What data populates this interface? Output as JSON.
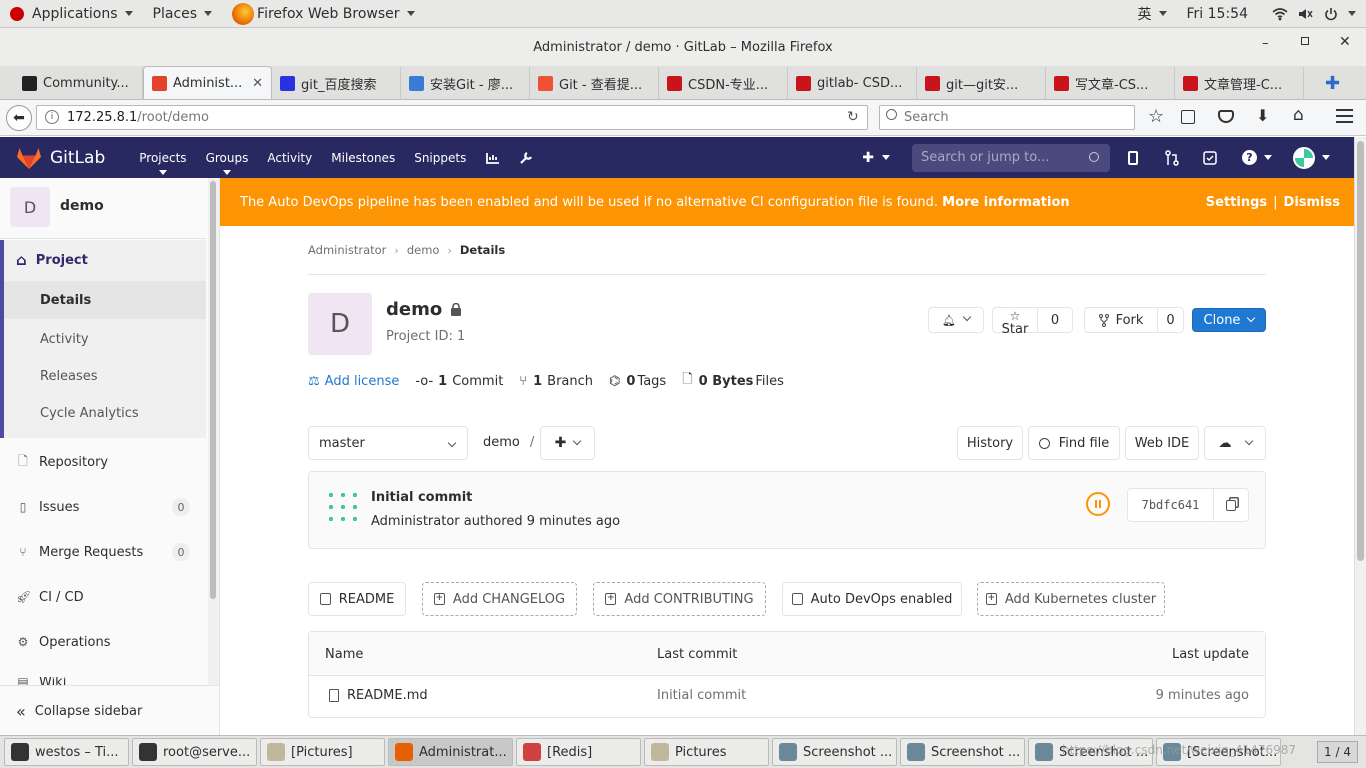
{
  "desktop": {
    "applications": "Applications",
    "places": "Places",
    "active_app": "Firefox Web Browser",
    "input_method": "英",
    "clock": "Fri 15:54"
  },
  "window": {
    "title": "Administrator / demo · GitLab – Mozilla Firefox"
  },
  "tabs": [
    {
      "label": "Community...",
      "icon": "community-icon",
      "color": "#222222"
    },
    {
      "label": "Administ...",
      "icon": "gitlab-icon",
      "color": "#e24329",
      "active": true
    },
    {
      "label": "git_百度搜索",
      "icon": "baidu-icon",
      "color": "#2932e1"
    },
    {
      "label": "安装Git - 廖...",
      "icon": "rocket-icon",
      "color": "#3a7bd5"
    },
    {
      "label": "Git - 查看提...",
      "icon": "git-icon",
      "color": "#f05033"
    },
    {
      "label": "CSDN-专业...",
      "icon": "csdn-icon",
      "color": "#c9141c"
    },
    {
      "label": "gitlab- CSD...",
      "icon": "csdn-icon",
      "color": "#c9141c"
    },
    {
      "label": "git—git安...",
      "icon": "csdn-icon",
      "color": "#c9141c"
    },
    {
      "label": "写文章-CS...",
      "icon": "csdn-icon",
      "color": "#c9141c"
    },
    {
      "label": "文章管理-C...",
      "icon": "csdn-icon",
      "color": "#c9141c"
    }
  ],
  "urlbar": {
    "host": "172.25.8.1",
    "path": "/root/demo",
    "search_placeholder": "Search"
  },
  "gitlab": {
    "logo": "GitLab",
    "nav": [
      "Projects",
      "Groups",
      "Activity",
      "Milestones",
      "Snippets"
    ],
    "search_placeholder": "Search or jump to...",
    "banner_text": "The Auto DevOps pipeline has been enabled and will be used if no alternative CI configuration file is found.",
    "banner_link": "More information",
    "banner_settings": "Settings",
    "banner_sep": "|",
    "banner_dismiss": "Dismiss"
  },
  "sidebar": {
    "avatar_letter": "D",
    "project_name": "demo",
    "section": "Project",
    "sub_items": [
      "Details",
      "Activity",
      "Releases",
      "Cycle Analytics"
    ],
    "items": [
      {
        "label": "Repository",
        "icon": "repository-icon"
      },
      {
        "label": "Issues",
        "icon": "issues-icon",
        "count": "0"
      },
      {
        "label": "Merge Requests",
        "icon": "merge-request-icon",
        "count": "0"
      },
      {
        "label": "CI / CD",
        "icon": "rocket-icon"
      },
      {
        "label": "Operations",
        "icon": "operations-icon"
      },
      {
        "label": "Wiki",
        "icon": "wiki-icon"
      }
    ],
    "collapse": "Collapse sidebar"
  },
  "breadcrumb": [
    "Administrator",
    "demo",
    "Details"
  ],
  "project": {
    "avatar_letter": "D",
    "name": "demo",
    "project_id": "Project ID: 1",
    "star_label": "Star",
    "star_count": "0",
    "fork_label": "Fork",
    "fork_count": "0",
    "clone_label": "Clone",
    "add_license": "Add license",
    "commits_num": "1",
    "commits_label": "Commit",
    "branches_num": "1",
    "branches_label": "Branch",
    "tags_num": "0",
    "tags_label": "Tags",
    "size_num": "0 Bytes",
    "size_label": "Files"
  },
  "repo": {
    "branch": "master",
    "path": "demo",
    "path_sep": "/",
    "history": "History",
    "find_file": "Find file",
    "web_ide": "Web IDE"
  },
  "commit": {
    "title": "Initial commit",
    "author": "Administrator",
    "authored": "authored",
    "time": "9 minutes ago",
    "sha": "7bdfc641",
    "status_color": "#fc9403"
  },
  "shortcuts": [
    "README",
    "Add CHANGELOG",
    "Add CONTRIBUTING",
    "Auto DevOps enabled",
    "Add Kubernetes cluster"
  ],
  "files_table": {
    "headers": [
      "Name",
      "Last commit",
      "Last update"
    ],
    "rows": [
      {
        "name": "README.md",
        "commit": "Initial commit",
        "updated": "9 minutes ago"
      }
    ]
  },
  "taskbar": [
    {
      "label": "westos – Ti...",
      "icon": "terminal-icon"
    },
    {
      "label": "root@serve...",
      "icon": "terminal-icon"
    },
    {
      "label": "[Pictures]",
      "icon": "folder-icon"
    },
    {
      "label": "Administrat...",
      "icon": "firefox-icon",
      "active": true
    },
    {
      "label": "[Redis]",
      "icon": "editor-icon"
    },
    {
      "label": "Pictures",
      "icon": "folder-icon"
    },
    {
      "label": "Screenshot ...",
      "icon": "screenshot-icon"
    },
    {
      "label": "Screenshot ...",
      "icon": "screenshot-icon"
    },
    {
      "label": "Screenshot ...",
      "icon": "screenshot-icon"
    },
    {
      "label": "[Screenshot...",
      "icon": "screenshot-icon"
    }
  ],
  "workspace": "1 / 4",
  "watermark": "https://blog.csdn.net/weixin_41476987"
}
